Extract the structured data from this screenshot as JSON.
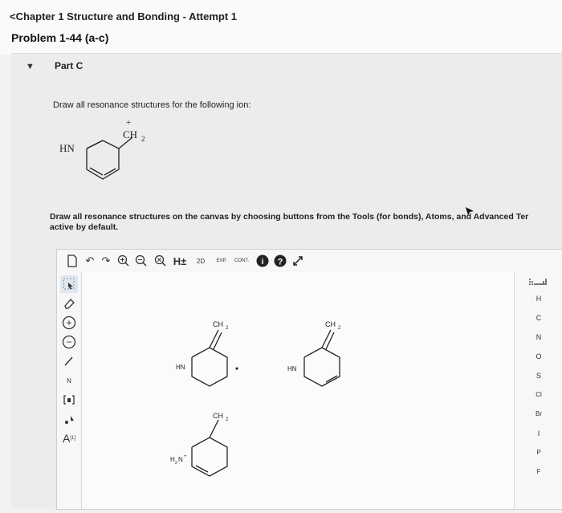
{
  "header": {
    "breadcrumb": "<Chapter 1 Structure and Bonding - Attempt 1",
    "problem_title": "Problem 1-44 (a-c)"
  },
  "part": {
    "toggle_icon": "triangle-down-icon",
    "label": "Part C",
    "prompt": "Draw all resonance structures for the following ion:",
    "ion": {
      "hn_label": "HN",
      "ch2_label": "CH",
      "ch2_sub": "2",
      "charge": "+"
    },
    "instructions_line1": "Draw all resonance structures on the canvas by choosing buttons from the Tools (for bonds), Atoms, and Advanced Ter",
    "instructions_line2": "active by default."
  },
  "toolbar": {
    "h_label": "H±",
    "twod_label": "2D",
    "exp_label": "EXP.",
    "cont_label": "CONT.",
    "help_label": "?",
    "info_label": "i"
  },
  "left_tools": {
    "plus_label": "+",
    "minus_label": "−",
    "n_label": "N",
    "a_label": "A",
    "a_sup": "[1]"
  },
  "atoms": [
    "H",
    "C",
    "N",
    "O",
    "S",
    "Cl",
    "Br",
    "I",
    "P",
    "F"
  ],
  "structures": {
    "s1": {
      "ch2": "CH",
      "sub": "2",
      "n": "HN"
    },
    "s2": {
      "ch2": "CH",
      "sub": "2",
      "n": "HN"
    },
    "s3": {
      "ch2": "CH",
      "sub": "2",
      "n": "H",
      "n2": "N",
      "nsub": "2",
      "charge": "+"
    }
  }
}
